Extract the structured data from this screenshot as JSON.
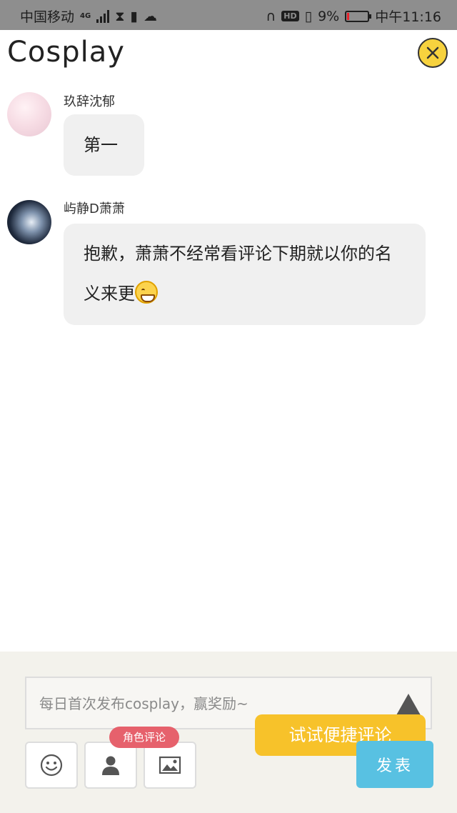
{
  "status_bar": {
    "carrier": "中国移动",
    "network": "4G",
    "battery": "9%",
    "time": "中午11:16",
    "hd": "HD",
    "battery_level": 0.09,
    "battery_color": "#e8222c"
  },
  "header": {
    "title": "Cosplay",
    "close_icon": "close-icon",
    "close_color": "#f7d23e"
  },
  "comments": [
    {
      "username": "玖辞沈郁",
      "text": "第一"
    },
    {
      "username": "屿静D萧萧",
      "text": "抱歉，萧萧不经常看评论下期就以你的名义来更"
    }
  ],
  "composer": {
    "placeholder": "每日首次发布cosplay，赢奖励~",
    "tip": "试试便捷评论",
    "role_badge": "角色评论",
    "send_label": "发表",
    "tip_color": "#f7c22a",
    "send_color": "#58c1e2",
    "badge_color": "#e6616c",
    "tools": [
      "emoji-icon",
      "person-icon",
      "image-icon"
    ]
  }
}
